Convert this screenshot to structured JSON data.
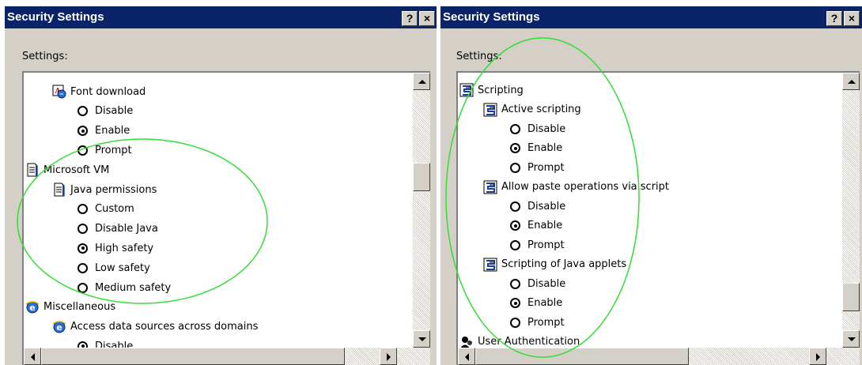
{
  "dialogs": [
    {
      "title": "Security Settings",
      "help_button": "?",
      "close_button": "×",
      "settings_label": "Settings:",
      "items": [
        {
          "kind": "category",
          "icon": "font-download-icon",
          "label": "Font download"
        },
        {
          "kind": "option",
          "label": "Disable",
          "selected": false
        },
        {
          "kind": "option",
          "label": "Enable",
          "selected": true
        },
        {
          "kind": "option",
          "label": "Prompt",
          "selected": false
        },
        {
          "kind": "group",
          "icon": "document-icon",
          "label": "Microsoft VM"
        },
        {
          "kind": "category",
          "icon": "document-icon",
          "label": "Java permissions"
        },
        {
          "kind": "option",
          "label": "Custom",
          "selected": false
        },
        {
          "kind": "option",
          "label": "Disable Java",
          "selected": false
        },
        {
          "kind": "option",
          "label": "High safety",
          "selected": true
        },
        {
          "kind": "option",
          "label": "Low safety",
          "selected": false
        },
        {
          "kind": "option",
          "label": "Medium safety",
          "selected": false
        },
        {
          "kind": "group",
          "icon": "ie-icon",
          "label": "Miscellaneous"
        },
        {
          "kind": "category",
          "icon": "ie-icon",
          "label": "Access data sources across domains"
        },
        {
          "kind": "option",
          "label": "Disable",
          "selected": true
        }
      ]
    },
    {
      "title": "Security Settings",
      "help_button": "?",
      "close_button": "×",
      "settings_label": "Settings:",
      "items": [
        {
          "kind": "group",
          "icon": "script-icon",
          "label": "Scripting"
        },
        {
          "kind": "category",
          "icon": "script-icon",
          "label": "Active scripting"
        },
        {
          "kind": "option",
          "label": "Disable",
          "selected": false
        },
        {
          "kind": "option",
          "label": "Enable",
          "selected": true
        },
        {
          "kind": "option",
          "label": "Prompt",
          "selected": false
        },
        {
          "kind": "category",
          "icon": "script-icon",
          "label": "Allow paste operations via script"
        },
        {
          "kind": "option",
          "label": "Disable",
          "selected": false
        },
        {
          "kind": "option",
          "label": "Enable",
          "selected": true
        },
        {
          "kind": "option",
          "label": "Prompt",
          "selected": false
        },
        {
          "kind": "category",
          "icon": "script-icon",
          "label": "Scripting of Java applets"
        },
        {
          "kind": "option",
          "label": "Disable",
          "selected": false
        },
        {
          "kind": "option",
          "label": "Enable",
          "selected": true
        },
        {
          "kind": "option",
          "label": "Prompt",
          "selected": false
        },
        {
          "kind": "group",
          "icon": "user-icon",
          "label": "User Authentication"
        }
      ]
    }
  ],
  "colors": {
    "titlebar": "#0a246a",
    "dialog_face": "#d4d0c8",
    "highlight_ellipse": "#33dd33"
  }
}
